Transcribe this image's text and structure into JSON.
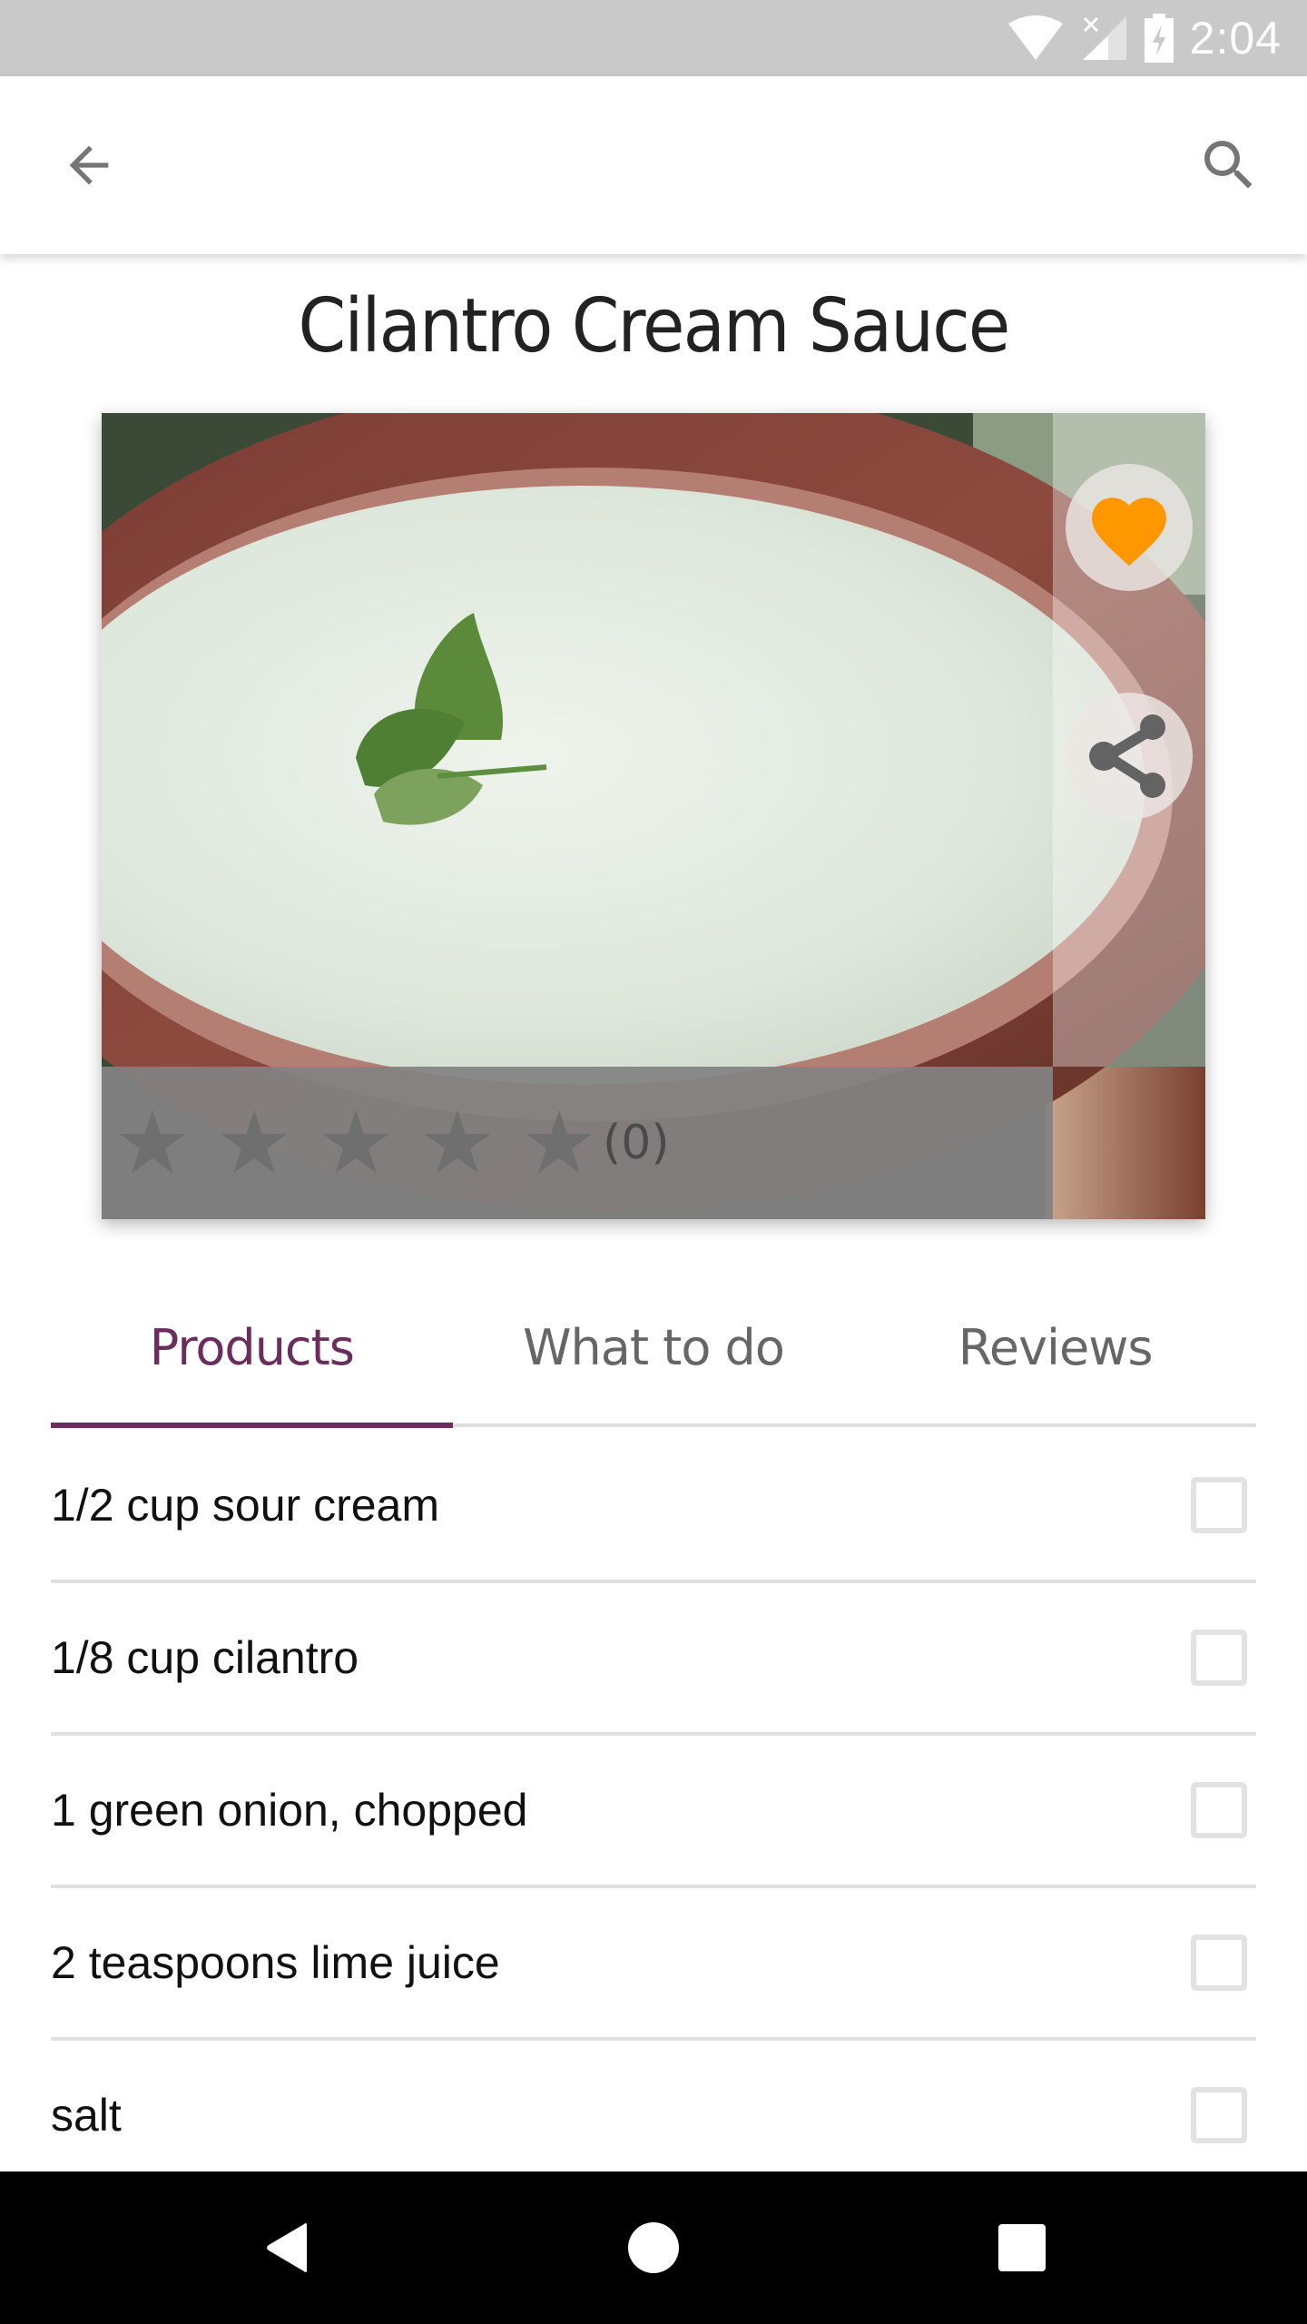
{
  "status_bar": {
    "time": "2:04",
    "icons": [
      "wifi-icon",
      "signal-no-service-icon",
      "battery-charging-icon"
    ]
  },
  "toolbar": {
    "back_icon": "arrow-back-icon",
    "search_icon": "search-icon"
  },
  "recipe": {
    "title": "Cilantro Cream Sauce",
    "image_alt": "Bowl of cilantro cream sauce garnished with a cilantro leaf",
    "favorite": true,
    "favorite_color": "#ff9800",
    "rating": {
      "stars_filled": 0,
      "stars_total": 5,
      "count_label": "(0)"
    }
  },
  "tabs": [
    {
      "label": "Products",
      "active": true
    },
    {
      "label": "What to do",
      "active": false
    },
    {
      "label": "Reviews",
      "active": false
    }
  ],
  "accent_color": "#6b2d5e",
  "ingredients": [
    {
      "label": "1/2 cup sour cream",
      "checked": false
    },
    {
      "label": "1/8 cup cilantro",
      "checked": false
    },
    {
      "label": "1 green onion, chopped",
      "checked": false
    },
    {
      "label": "2 teaspoons lime juice",
      "checked": false
    },
    {
      "label": "salt",
      "checked": false
    }
  ],
  "nav_bar": {
    "buttons": [
      "nav-back-icon",
      "nav-home-icon",
      "nav-recents-icon"
    ]
  }
}
